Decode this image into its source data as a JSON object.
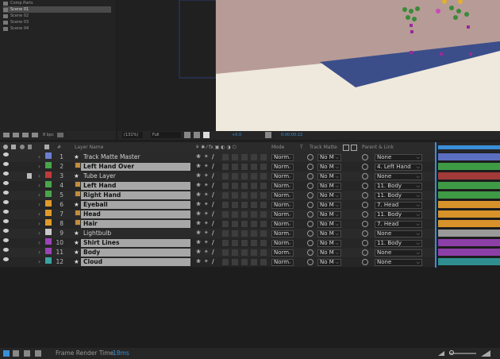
{
  "project": {
    "items": [
      {
        "label": "Comp Parts"
      },
      {
        "label": "Scene 01"
      },
      {
        "label": "Scene 02"
      },
      {
        "label": "Scene 03"
      },
      {
        "label": "Scene 04"
      }
    ],
    "bpc": "8 bpc"
  },
  "viewer": {
    "zoom": "(131%)",
    "resolution": "Full",
    "exposure": "+0.0",
    "timecode": "0:00:00:22"
  },
  "timeline": {
    "headers": {
      "num": "#",
      "layer_name": "Layer Name",
      "mode": "Mode",
      "t": "T",
      "track_matte": "Track Matte",
      "parent": "Parent & Link"
    },
    "layers": [
      {
        "num": "1",
        "name": "Track Matte Master",
        "mode": "Norm",
        "matte": "No M",
        "parent": "None",
        "color": "#6b7fd1",
        "selected": false,
        "tag": false,
        "bar": "#5b6fc0"
      },
      {
        "num": "2",
        "name": "Left Hand Over",
        "mode": "Norm",
        "matte": "No M",
        "parent": "4. Left Hand",
        "color": "#4aa54a",
        "selected": true,
        "tag": true,
        "bar": "#3f9a45"
      },
      {
        "num": "3",
        "name": "Tube Layer",
        "mode": "Norm",
        "matte": "No M",
        "parent": "None",
        "color": "#c03a3a",
        "selected": false,
        "tag": false,
        "bar": "#a33a3a"
      },
      {
        "num": "4",
        "name": "Left Hand",
        "mode": "Norm",
        "matte": "No M",
        "parent": "11. Body",
        "color": "#4aa54a",
        "selected": true,
        "tag": true,
        "bar": "#3f9a45"
      },
      {
        "num": "5",
        "name": "Right Hand",
        "mode": "Norm",
        "matte": "No M",
        "parent": "11. Body",
        "color": "#4aa54a",
        "selected": true,
        "tag": true,
        "bar": "#3f9a45"
      },
      {
        "num": "6",
        "name": "Eyeball",
        "mode": "Norm",
        "matte": "No M",
        "parent": "7. Head",
        "color": "#e09a2a",
        "selected": true,
        "tag": false,
        "bar": "#d8922a"
      },
      {
        "num": "7",
        "name": "Head",
        "mode": "Norm",
        "matte": "No M",
        "parent": "11. Body",
        "color": "#e09a2a",
        "selected": true,
        "tag": true,
        "bar": "#d8922a"
      },
      {
        "num": "8",
        "name": "Hair",
        "mode": "Norm",
        "matte": "No M",
        "parent": "7. Head",
        "color": "#e09a2a",
        "selected": true,
        "tag": true,
        "bar": "#d8922a"
      },
      {
        "num": "9",
        "name": "Lightbulb",
        "mode": "Norm",
        "matte": "No M",
        "parent": "None",
        "color": "#c9c9c9",
        "selected": false,
        "tag": false,
        "bar": "#9a9a9a"
      },
      {
        "num": "10",
        "name": "Shirt Lines",
        "mode": "Norm",
        "matte": "No M",
        "parent": "11. Body",
        "color": "#9b44b8",
        "selected": true,
        "tag": false,
        "bar": "#8d3fa8"
      },
      {
        "num": "11",
        "name": "Body",
        "mode": "Norm",
        "matte": "No M",
        "parent": "None",
        "color": "#9b44b8",
        "selected": true,
        "tag": false,
        "bar": "#8d3fa8"
      },
      {
        "num": "12",
        "name": "Cloud",
        "mode": "Norm",
        "matte": "No M",
        "parent": "None",
        "color": "#3aa3a3",
        "selected": true,
        "tag": false,
        "bar": "#2f8f8f"
      }
    ]
  },
  "footer": {
    "render_label": "Frame Render Time",
    "render_value": "18ms"
  },
  "colors": {
    "accent": "#3a8fd8",
    "sky": "#b79b96",
    "ground": "#efe8dc",
    "ramp": "#3b4e8a"
  }
}
